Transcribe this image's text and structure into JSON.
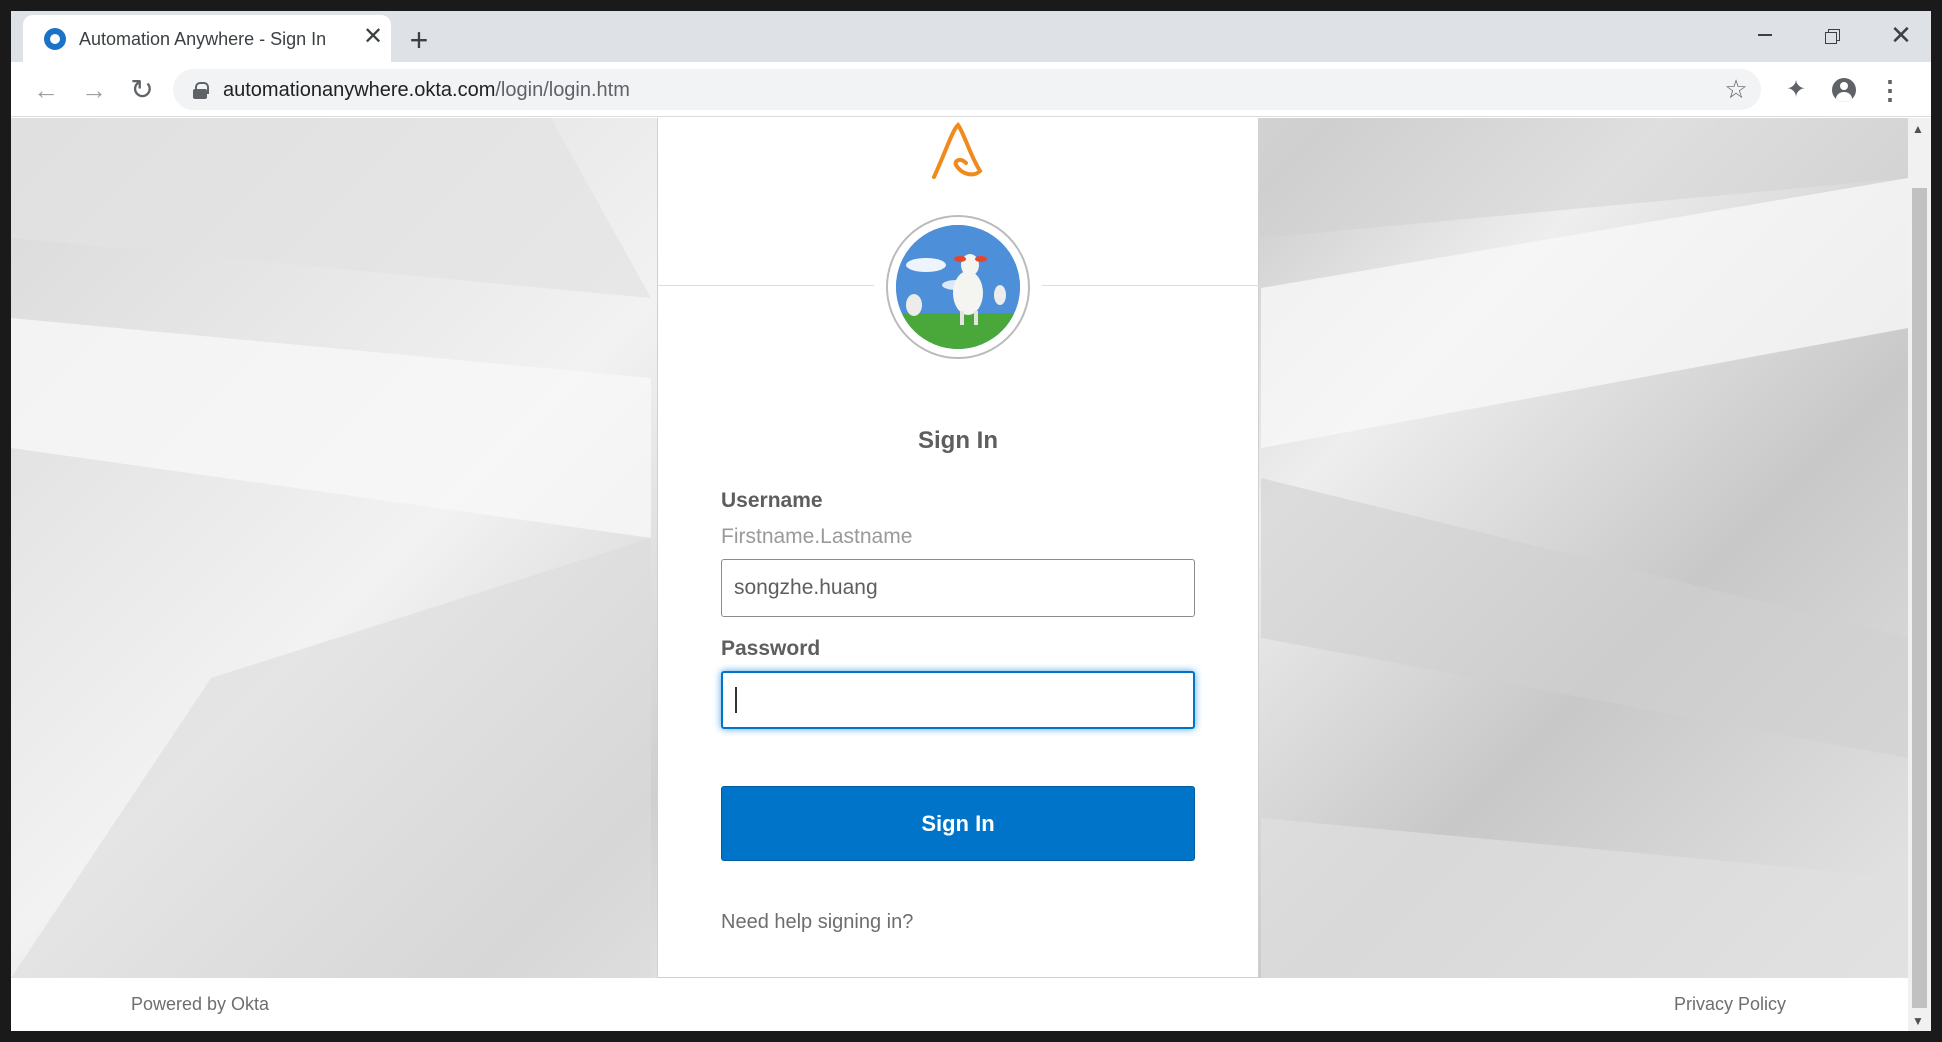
{
  "browser": {
    "tab": {
      "title": "Automation Anywhere - Sign In",
      "favicon": "okta-circle-icon"
    },
    "new_tab_label": "+",
    "url_host": "automationanywhere.okta.com",
    "url_path": "/login/login.htm"
  },
  "card": {
    "logo": "automation-anywhere-logo",
    "title": "Sign In",
    "username_label": "Username",
    "username_hint": "Firstname.Lastname",
    "username_value": "songzhe.huang",
    "password_label": "Password",
    "password_value": "",
    "signin_button": "Sign In",
    "help_link": "Need help signing in?"
  },
  "footer": {
    "powered_by": "Powered by Okta",
    "privacy": "Privacy Policy"
  },
  "colors": {
    "primary_button": "#0074c8",
    "focus_border": "#0074c8",
    "tab_strip": "#dee1e6"
  }
}
